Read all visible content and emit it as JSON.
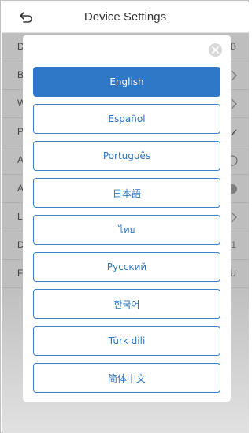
{
  "header": {
    "title": "Device Settings",
    "back_icon": "back-arrow-icon"
  },
  "background_rows": [
    {
      "label": "D",
      "value": "B"
    },
    {
      "label": "B",
      "value": ""
    },
    {
      "label": "W",
      "value": ""
    },
    {
      "label": "P",
      "value": ""
    },
    {
      "label": "A",
      "value": ""
    },
    {
      "label": "A",
      "value": ""
    },
    {
      "label": "La",
      "value": ""
    },
    {
      "label": "D",
      "value": "1"
    },
    {
      "label": "Fi",
      "value": "U"
    }
  ],
  "dialog": {
    "close_icon": "close-icon",
    "languages": [
      {
        "label": "English",
        "selected": true
      },
      {
        "label": "Español",
        "selected": false
      },
      {
        "label": "Português",
        "selected": false
      },
      {
        "label": "日本語",
        "selected": false
      },
      {
        "label": "ไทย",
        "selected": false
      },
      {
        "label": "Русский",
        "selected": false
      },
      {
        "label": "한국어",
        "selected": false
      },
      {
        "label": "Türk dili",
        "selected": false
      },
      {
        "label": "简体中文",
        "selected": false
      }
    ]
  },
  "colors": {
    "accent": "#2f78c7",
    "overlay": "#464646"
  }
}
